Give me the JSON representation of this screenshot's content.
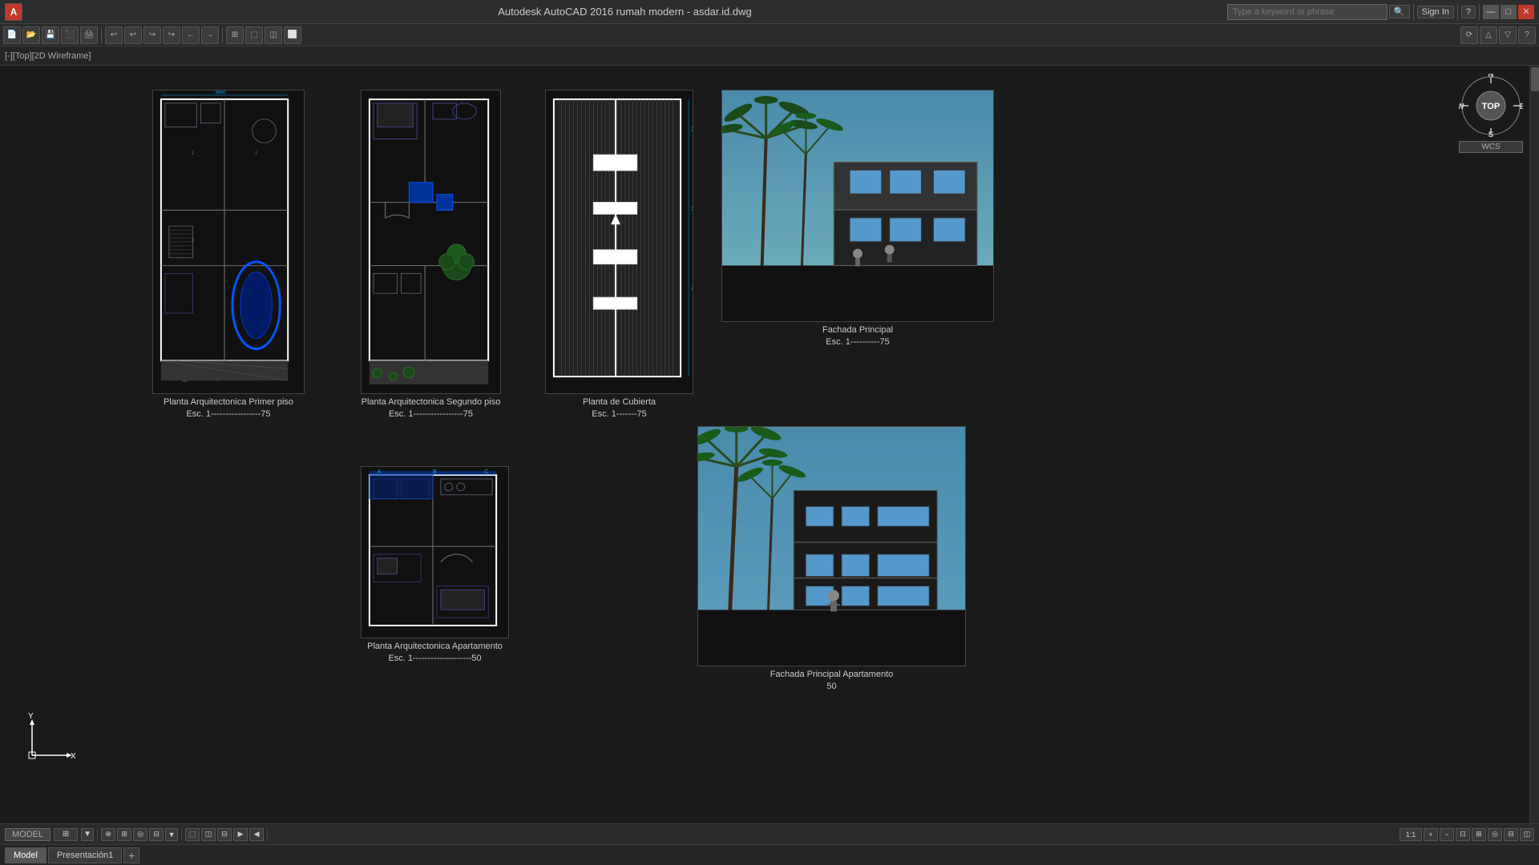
{
  "titlebar": {
    "app_name": "Autodesk AutoCAD 2016",
    "file_name": "rumah modern - asdar.id.dwg",
    "title_full": "Autodesk AutoCAD 2016    rumah modern - asdar.id.dwg",
    "search_placeholder": "Type a keyword or phrase",
    "sign_in": "Sign In",
    "min_label": "—",
    "max_label": "□",
    "close_label": "✕"
  },
  "toolbar": {
    "icons": [
      "A",
      "□",
      "↩",
      "↪",
      "←",
      "→",
      "⬜",
      "⬛",
      "📄",
      "💾",
      "✂",
      "📋",
      "↕",
      "⬚",
      "⊞"
    ]
  },
  "viewport": {
    "label": "[-][Top][2D Wireframe]"
  },
  "compass": {
    "n": "N",
    "s": "S",
    "e": "E",
    "w": "W",
    "top_label": "TOP",
    "wcs_label": "WCS"
  },
  "drawings": [
    {
      "id": "planta1",
      "caption_line1": "Planta Arquitectonica Primer piso",
      "caption_line2": "Esc. 1-----------------75"
    },
    {
      "id": "planta2",
      "caption_line1": "Planta Arquitectonica Segundo piso",
      "caption_line2": "Esc. 1-----------------75"
    },
    {
      "id": "planta3",
      "caption_line1": "Planta de Cubierta",
      "caption_line2": "Esc. 1-------75"
    },
    {
      "id": "fachada1",
      "caption_line1": "Fachada Principal",
      "caption_line2": "Esc. 1----------75"
    },
    {
      "id": "planta4",
      "caption_line1": "Planta Arquitectonica Apartamento",
      "caption_line2": "Esc. 1--------------------50"
    },
    {
      "id": "fachada2",
      "caption_line1": "Fachada Principal Apartamento",
      "caption_line2": "         50"
    }
  ],
  "tabs": {
    "model_label": "Model",
    "presentacion_label": "Presentación1",
    "add_label": "+"
  },
  "statusbar": {
    "model_label": "MODEL",
    "zoom_label": "1:1",
    "coords": ""
  }
}
